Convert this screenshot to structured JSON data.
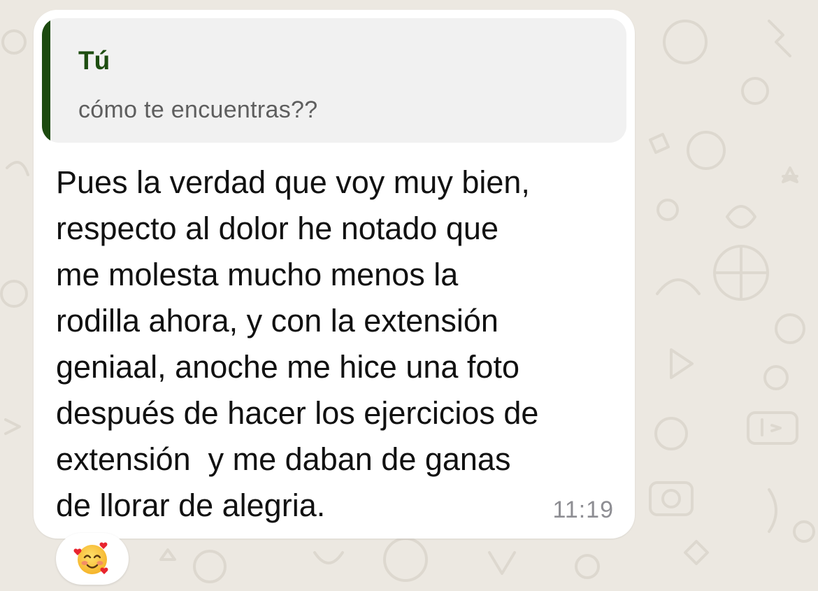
{
  "quoted_message": {
    "author": "Tú",
    "text": "cómo te encuentras??"
  },
  "message": {
    "lines": [
      "Pues la verdad que voy muy bien,",
      "respecto al dolor he notado que",
      "me molesta mucho menos la",
      "rodilla ahora, y con la extensión",
      "geniaal, anoche me hice una foto",
      "después de hacer los ejercicios de",
      "extensión  y me daban de ganas",
      "de llorar de alegria."
    ],
    "time": "11:19"
  },
  "reaction": {
    "icon": "smiling-face-with-hearts-icon"
  },
  "colors": {
    "wallpaper": "#ECE8E1",
    "bubble": "#FFFFFF",
    "quote_background": "#F1F1F1",
    "quote_accent": "#1C4A0F",
    "quote_author": "#1D4D10",
    "timestamp": "#8E8E93"
  }
}
